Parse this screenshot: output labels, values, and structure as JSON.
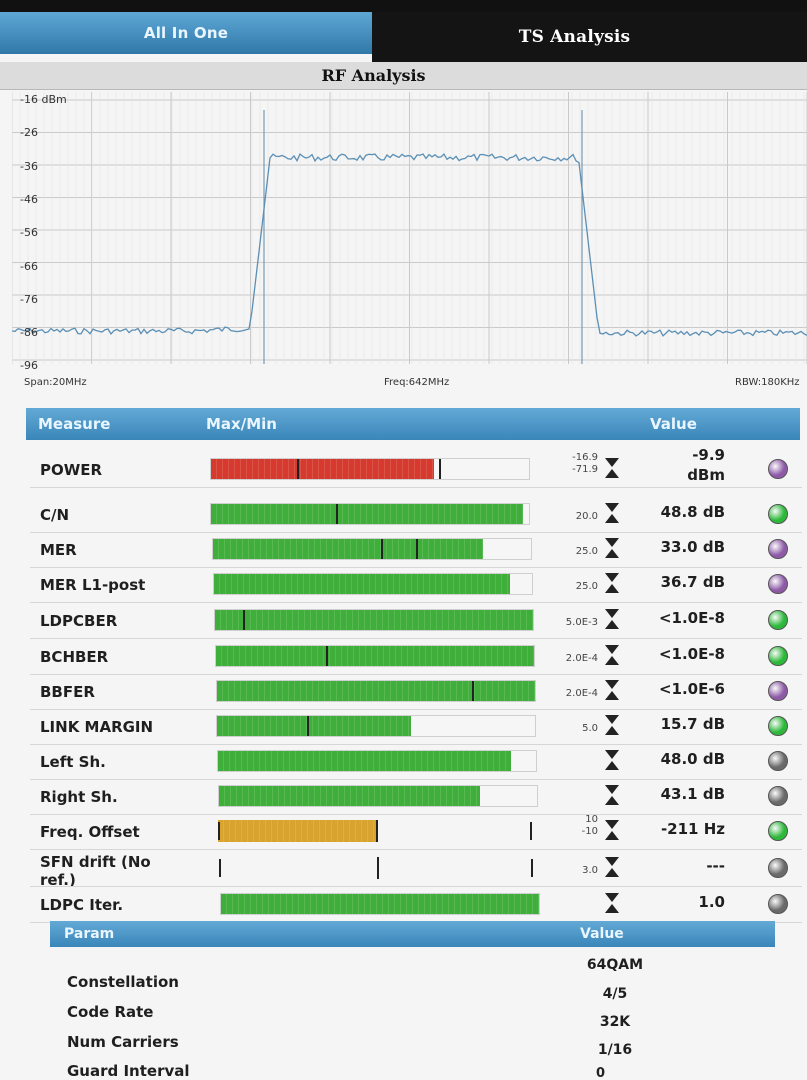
{
  "tabs": {
    "all_in_one": "All In One",
    "ts_analysis": "TS Analysis"
  },
  "rf_title": "RF Analysis",
  "spectrum": {
    "y_ticks": [
      "-16 dBm",
      "-26",
      "-36",
      "-46",
      "-56",
      "-66",
      "-76",
      "-86",
      "-96"
    ],
    "span": "Span:20MHz",
    "freq": "Freq:642MHz",
    "rbw": "RBW:180KHz",
    "trace_color": "#5b8fb5"
  },
  "measure_header": {
    "measure": "Measure",
    "maxmin": "Max/Min",
    "value": "Value"
  },
  "measures": [
    {
      "name": "POWER",
      "lim_top": "-16.9",
      "lim_bot": "-71.9",
      "value_line1": "-9.9",
      "value_line2": "dBm",
      "bar_color": "#d63a2e",
      "dot_color": "#8e5aa8",
      "fill": 0.7
    },
    {
      "name": "C/N",
      "lim_top": "",
      "lim_bot": "20.0",
      "value_line1": "48.8 dB",
      "value_line2": "",
      "bar_color": "#3fae3b",
      "dot_color": "#2db83a",
      "fill": 0.98
    },
    {
      "name": "MER",
      "lim_top": "",
      "lim_bot": "25.0",
      "value_line1": "33.0 dB",
      "value_line2": "",
      "bar_color": "#3fae3b",
      "dot_color": "#8e5aa8",
      "fill": 0.85
    },
    {
      "name": "MER L1-post",
      "lim_top": "",
      "lim_bot": "25.0",
      "value_line1": "36.7 dB",
      "value_line2": "",
      "bar_color": "#3fae3b",
      "dot_color": "#8e5aa8",
      "fill": 0.93
    },
    {
      "name": "LDPCBER",
      "lim_top": "",
      "lim_bot": "5.0E-3",
      "value_line1": "<1.0E-8",
      "value_line2": "",
      "bar_color": "#3fae3b",
      "dot_color": "#2db83a",
      "fill": 1.0
    },
    {
      "name": "BCHBER",
      "lim_top": "",
      "lim_bot": "2.0E-4",
      "value_line1": "<1.0E-8",
      "value_line2": "",
      "bar_color": "#3fae3b",
      "dot_color": "#2db83a",
      "fill": 1.0
    },
    {
      "name": "BBFER",
      "lim_top": "",
      "lim_bot": "2.0E-4",
      "value_line1": "<1.0E-6",
      "value_line2": "",
      "bar_color": "#3fae3b",
      "dot_color": "#8e5aa8",
      "fill": 1.0
    },
    {
      "name": "LINK MARGIN",
      "lim_top": "",
      "lim_bot": "5.0",
      "value_line1": "15.7 dB",
      "value_line2": "",
      "bar_color": "#3fae3b",
      "dot_color": "#2db83a",
      "fill": 0.61
    },
    {
      "name": "Left Sh.",
      "lim_top": "",
      "lim_bot": "",
      "value_line1": "48.0 dB",
      "value_line2": "",
      "bar_color": "#3fae3b",
      "dot_color": "#6a6a6a",
      "fill": 0.92
    },
    {
      "name": "Right Sh.",
      "lim_top": "",
      "lim_bot": "",
      "value_line1": "43.1 dB",
      "value_line2": "",
      "bar_color": "#3fae3b",
      "dot_color": "#6a6a6a",
      "fill": 0.82
    },
    {
      "name": "Freq. Offset",
      "lim_top": "10",
      "lim_bot": "-10",
      "value_line1": "-211 Hz",
      "value_line2": "",
      "bar_color": "#d9a330",
      "dot_color": "#2db83a",
      "fill": 0.5
    },
    {
      "name": "SFN drift (No ref.)",
      "lim_top": "",
      "lim_bot": "3.0",
      "value_line1": "---",
      "value_line2": "",
      "bar_color": "#3fae3b",
      "dot_color": "#6a6a6a",
      "fill": 0.0
    },
    {
      "name": "LDPC Iter.",
      "lim_top": "",
      "lim_bot": "",
      "value_line1": "1.0",
      "value_line2": "",
      "bar_color": "#3fae3b",
      "dot_color": "#6a6a6a",
      "fill": 1.0
    }
  ],
  "param_header": {
    "param": "Param",
    "value": "Value"
  },
  "params": [
    {
      "name": "Constellation",
      "value": "64QAM"
    },
    {
      "name": "Code Rate",
      "value": "4/5"
    },
    {
      "name": "Num Carriers",
      "value": "32K"
    },
    {
      "name": "Guard Interval",
      "value": "1/16"
    }
  ],
  "partial_value": "0"
}
